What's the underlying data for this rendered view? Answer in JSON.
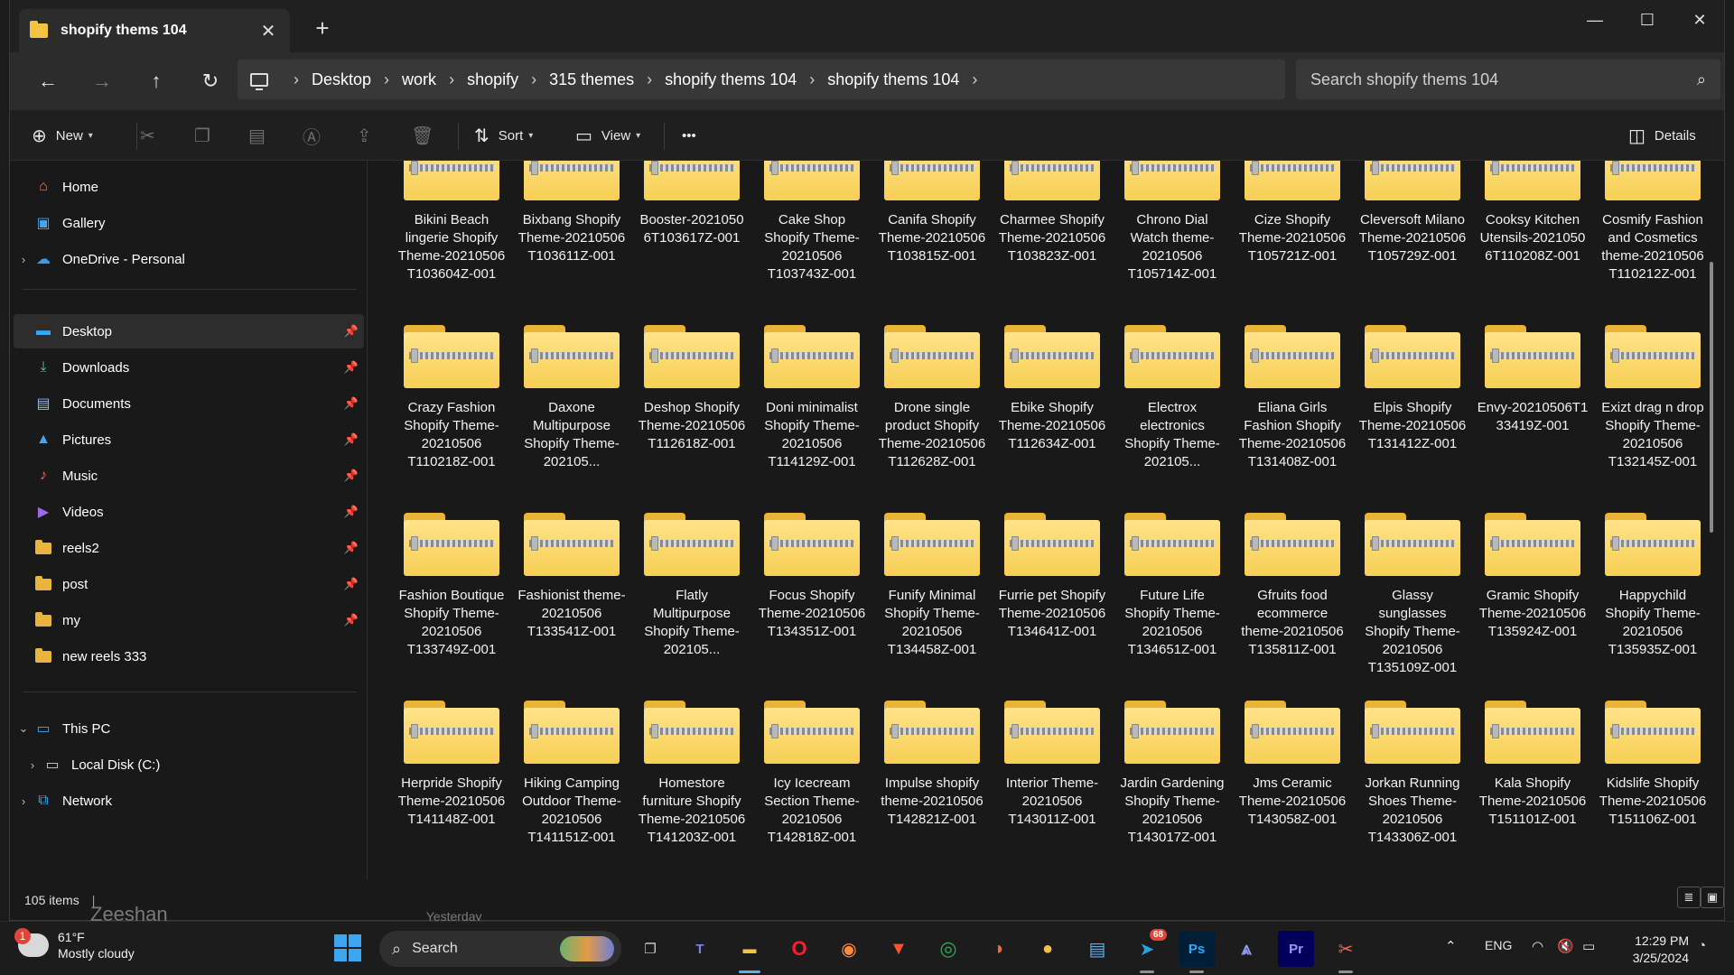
{
  "window": {
    "tab_title": "shopify thems 104",
    "new_tab_label": "+",
    "controls": {
      "minimize": "—",
      "maximize": "☐",
      "close": "✕"
    }
  },
  "nav": {
    "breadcrumbs": [
      "Desktop",
      "work",
      "shopify",
      "315 themes",
      "shopify thems 104",
      "shopify thems 104"
    ],
    "search_placeholder": "Search shopify thems 104"
  },
  "toolbar": {
    "new_label": "New",
    "sort_label": "Sort",
    "view_label": "View",
    "more_label": "•••",
    "details_label": "Details"
  },
  "sidebar": {
    "quick": [
      {
        "label": "Home",
        "icon": "home-icon"
      },
      {
        "label": "Gallery",
        "icon": "gallery-icon"
      },
      {
        "label": "OneDrive - Personal",
        "icon": "cloud-icon"
      }
    ],
    "pinned": [
      {
        "label": "Desktop",
        "icon": "desktop-icon",
        "selected": true
      },
      {
        "label": "Downloads",
        "icon": "download-icon"
      },
      {
        "label": "Documents",
        "icon": "document-icon"
      },
      {
        "label": "Pictures",
        "icon": "pictures-icon"
      },
      {
        "label": "Music",
        "icon": "music-icon"
      },
      {
        "label": "Videos",
        "icon": "video-icon"
      },
      {
        "label": "reels2",
        "icon": "folder-icon"
      },
      {
        "label": "post",
        "icon": "folder-icon"
      },
      {
        "label": "my",
        "icon": "folder-icon"
      },
      {
        "label": "new reels 333",
        "icon": "folder-icon"
      }
    ],
    "devices": [
      {
        "label": "This PC",
        "icon": "pc-icon"
      },
      {
        "label": "Local Disk (C:)",
        "icon": "disk-icon"
      },
      {
        "label": "Network",
        "icon": "network-icon"
      }
    ]
  },
  "files": [
    "Bikini Beach lingerie Shopify Theme-20210506 T103604Z-001",
    "Bixbang Shopify Theme-20210506 T103611Z-001",
    "Booster-2021050 6T103617Z-001",
    "Cake Shop Shopify Theme-20210506 T103743Z-001",
    "Canifa Shopify Theme-20210506 T103815Z-001",
    "Charmee Shopify Theme-20210506 T103823Z-001",
    "Chrono Dial Watch theme-20210506 T105714Z-001",
    "Cize Shopify Theme-20210506 T105721Z-001",
    "Cleversoft Milano Theme-20210506 T105729Z-001",
    "Cooksy Kitchen Utensils-2021050 6T110208Z-001",
    "Cosmify Fashion and Cosmetics theme-20210506 T110212Z-001",
    "Crazy Fashion Shopify Theme-20210506 T110218Z-001",
    "Daxone Multipurpose Shopify Theme-202105...",
    "Deshop Shopify Theme-20210506 T112618Z-001",
    "Doni minimalist Shopify Theme-20210506 T114129Z-001",
    "Drone single product Shopify Theme-20210506 T112628Z-001",
    "Ebike Shopify Theme-20210506 T112634Z-001",
    "Electrox electronics Shopify Theme-202105...",
    "Eliana Girls Fashion Shopify Theme-20210506 T131408Z-001",
    "Elpis Shopify Theme-20210506 T131412Z-001",
    "Envy-20210506T1 33419Z-001",
    "Exizt drag n drop Shopify Theme-20210506 T132145Z-001",
    "Fashion Boutique Shopify Theme-20210506 T133749Z-001",
    "Fashionist theme-20210506 T133541Z-001",
    "Flatly Multipurpose Shopify Theme-202105...",
    "Focus Shopify Theme-20210506 T134351Z-001",
    "Funify Minimal Shopify Theme-20210506 T134458Z-001",
    "Furrie pet Shopify Theme-20210506 T134641Z-001",
    "Future Life Shopify Theme-20210506 T134651Z-001",
    "Gfruits food ecommerce theme-20210506 T135811Z-001",
    "Glassy sunglasses Shopify Theme-20210506 T135109Z-001",
    "Gramic Shopify Theme-20210506 T135924Z-001",
    "Happychild Shopify Theme-20210506 T135935Z-001",
    "Herpride Shopify Theme-20210506 T141148Z-001",
    "Hiking Camping Outdoor Theme-20210506 T141151Z-001",
    "Homestore furniture Shopify Theme-20210506 T141203Z-001",
    "Icy Icecream Section Theme-20210506 T142818Z-001",
    "Impulse shopify theme-20210506 T142821Z-001",
    "Interior Theme-20210506 T143011Z-001",
    "Jardin Gardening Shopify Theme-20210506 T143017Z-001",
    "Jms Ceramic Theme-20210506 T143058Z-001",
    "Jorkan Running Shoes Theme-20210506 T143306Z-001",
    "Kala Shopify Theme-20210506 T151101Z-001",
    "Kidslife Shopify Theme-20210506 T151106Z-001"
  ],
  "status": {
    "item_count": "105 items",
    "separator": "|"
  },
  "behind_text": {
    "name": "Zeeshan",
    "time": "Yesterday"
  },
  "taskbar": {
    "weather_temp": "61°F",
    "weather_desc": "Mostly cloudy",
    "weather_badge": "1",
    "search_label": "Search",
    "telegram_badge": "68",
    "ps_label": "Ps",
    "pr_label": "Pr",
    "lang": "ENG",
    "time": "12:29 PM",
    "date": "3/25/2024"
  },
  "colors": {
    "folder": "#f7cf55",
    "accent": "#3ca7f0",
    "background": "#191919"
  }
}
